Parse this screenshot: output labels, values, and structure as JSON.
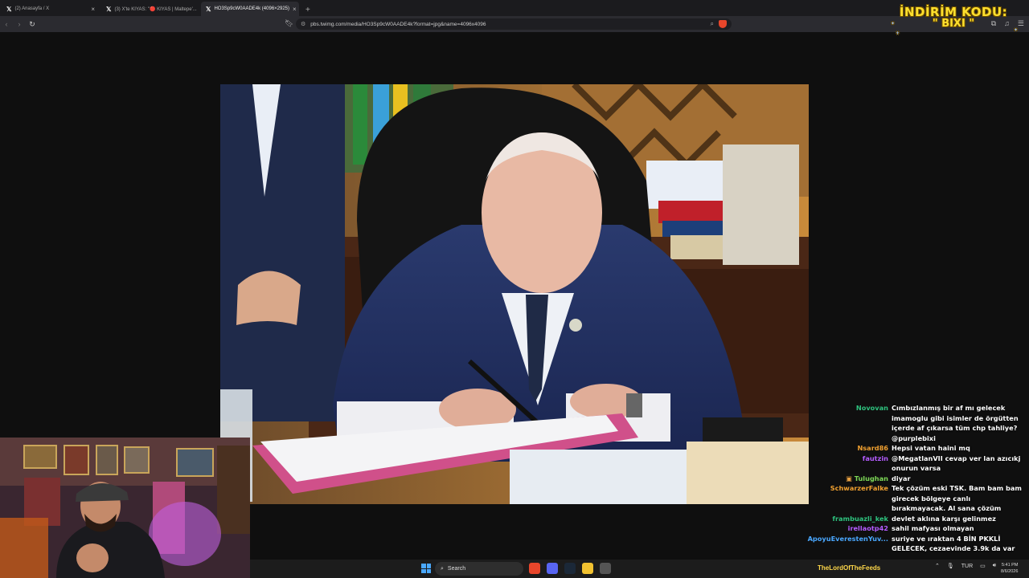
{
  "browser": {
    "tabs": [
      {
        "title": "(2) Anasayfa / X",
        "active": false
      },
      {
        "title": "(3) X'te KIYAS: \"🔴 KIYAS | Maltepe'...",
        "active": false
      },
      {
        "title": "HO3Sp9cW0AADE4k (4096×2925)",
        "active": true
      }
    ],
    "new_tab_label": "+",
    "url": "pbs.twimg.com/media/HO3Sp9cW0AADE4k?format=jpg&name=4096x4096"
  },
  "overlay": {
    "promo_line1": "İNDİRİM KODU:",
    "promo_line2": "\" BIXI \"",
    "streamer_name": "TheLordOfTheFeeds"
  },
  "chat": [
    {
      "user": "Novovan",
      "color": "#2ec27e",
      "text": "Cımbızlanmış bir af mı gelecek imamoglu gibi isimler de örgütten içerde af çıkarsa tüm chp tahliye? @purplebixi"
    },
    {
      "user": "Nsard86",
      "color": "#f0a030",
      "text": "Hepsi vatan haini mq"
    },
    {
      "user": "fautzin",
      "color": "#b45cff",
      "text": "@MegatlanVII cevap ver lan azıcıkj onurun varsa"
    },
    {
      "user": "Tulughan",
      "color": "#7ed957",
      "text": "diyar",
      "badge": true
    },
    {
      "user": "SchwarzerFalke",
      "color": "#f0a030",
      "text": "Tek çözüm eski TSK. Bam bam bam girecek bölgeye canlı bırakmayacak. Al sana çözüm"
    },
    {
      "user": "frambuazli_kek",
      "color": "#2ec27e",
      "text": "devlet aklına karşı gelinmez"
    },
    {
      "user": "irellaotp42",
      "color": "#b45cff",
      "text": "sahil mafyası olmayan"
    },
    {
      "user": "ApoyuEverestenYuv...",
      "color": "#4aa8ff",
      "text": "suriye ve ıraktan 4 BİN PKKLİ GELECEK, cezaevinde 3.9k da var"
    }
  ],
  "taskbar": {
    "search_label": "Search",
    "language": "TUR",
    "time": "5:41 PM",
    "date": "8/6/2026"
  },
  "colors": {
    "promo_yellow": "#ffe02e",
    "streamer_gold": "#ffd84a",
    "browser_bg": "#2b2b30",
    "brave_shield": "#e8462b"
  }
}
